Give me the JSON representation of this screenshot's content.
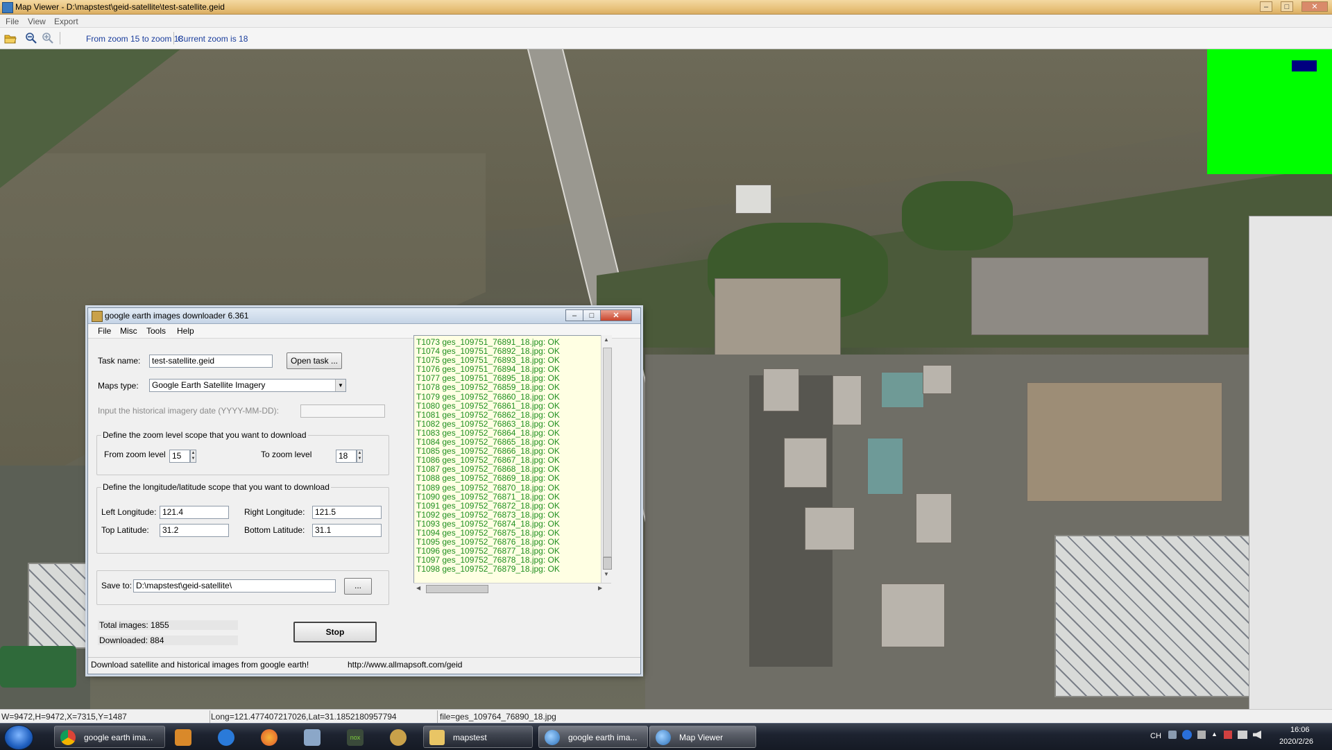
{
  "window": {
    "title": "Map Viewer - D:\\mapstest\\geid-satellite\\test-satellite.geid",
    "controls": {
      "minimize": "‒",
      "maximize": "□",
      "close": "✕"
    }
  },
  "menu": [
    "File",
    "View",
    "Export"
  ],
  "toolbar": {
    "zoom_range": "From zoom 15 to zoom 18",
    "current_zoom": "Current zoom is 18"
  },
  "statusbar": {
    "dims": "W=9472,H=9472,X=7315,Y=1487",
    "coords": "Long=121.477407217026,Lat=31.1852180957794",
    "file": "file=ges_109764_76890_18.jpg"
  },
  "downloader": {
    "title": "google earth images downloader 6.361",
    "menu": [
      "File",
      "Misc",
      "Tools",
      "Help"
    ],
    "task_label": "Task name:",
    "task_value": "test-satellite.geid",
    "open_task_button": "Open task ...",
    "maps_type_label": "Maps type:",
    "maps_type_value": "Google Earth Satellite Imagery",
    "historical_label": "Input the  historical imagery date (YYYY-MM-DD):",
    "historical_value": "",
    "zoom_group_caption": "Define the zoom level scope that you want to download",
    "from_zoom_label": "From zoom level",
    "from_zoom_value": "15",
    "to_zoom_label": "To zoom level",
    "to_zoom_value": "18",
    "lonlat_group_caption": "Define the longitude/latitude scope that you want to download",
    "left_lon_label": "Left Longitude:",
    "left_lon_value": "121.4",
    "right_lon_label": "Right Longitude:",
    "right_lon_value": "121.5",
    "top_lat_label": "Top Latitude:",
    "top_lat_value": "31.2",
    "bottom_lat_label": "Bottom Latitude:",
    "bottom_lat_value": "31.1",
    "save_to_label": "Save to:",
    "save_to_value": "D:\\mapstest\\geid-satellite\\",
    "browse_button": "...",
    "total_images": "Total images: 1855",
    "downloaded": "Downloaded: 884",
    "stop_button": "Stop",
    "status_left": "Download satellite and historical  images from google earth!",
    "status_url": "http://www.allmapsoft.com/geid",
    "log": [
      "T1073 ges_109751_76891_18.jpg:  OK",
      "T1074 ges_109751_76892_18.jpg:  OK",
      "T1075 ges_109751_76893_18.jpg:  OK",
      "T1076 ges_109751_76894_18.jpg:  OK",
      "T1077 ges_109751_76895_18.jpg:  OK",
      "T1078 ges_109752_76859_18.jpg:  OK",
      "T1079 ges_109752_76860_18.jpg:  OK",
      "T1080 ges_109752_76861_18.jpg:  OK",
      "T1081 ges_109752_76862_18.jpg:  OK",
      "T1082 ges_109752_76863_18.jpg:  OK",
      "T1083 ges_109752_76864_18.jpg:  OK",
      "T1084 ges_109752_76865_18.jpg:  OK",
      "T1085 ges_109752_76866_18.jpg:  OK",
      "T1086 ges_109752_76867_18.jpg:  OK",
      "T1087 ges_109752_76868_18.jpg:  OK",
      "T1088 ges_109752_76869_18.jpg:  OK",
      "T1089 ges_109752_76870_18.jpg:  OK",
      "T1090 ges_109752_76871_18.jpg:  OK",
      "T1091 ges_109752_76872_18.jpg:  OK",
      "T1092 ges_109752_76873_18.jpg:  OK",
      "T1093 ges_109752_76874_18.jpg:  OK",
      "T1094 ges_109752_76875_18.jpg:  OK",
      "T1095 ges_109752_76876_18.jpg:  OK",
      "T1096 ges_109752_76877_18.jpg:  OK",
      "T1097 ges_109752_76878_18.jpg:  OK",
      "T1098 ges_109752_76879_18.jpg:  OK"
    ]
  },
  "taskbar": {
    "tasks": [
      {
        "label": "google earth ima...",
        "icon": "chrome-icon"
      },
      {
        "label": "mapstest",
        "icon": "folder-icon"
      },
      {
        "label": "google earth ima...",
        "icon": "globe-icon"
      },
      {
        "label": "Map Viewer",
        "icon": "globe-icon"
      }
    ],
    "tray": {
      "lang": "CH",
      "time": "16:06",
      "date": "2020/2/26"
    }
  },
  "colors": {
    "log_text": "#1f8f1f",
    "overlay_green": "#00ff00",
    "overlay_blue": "#000080"
  }
}
